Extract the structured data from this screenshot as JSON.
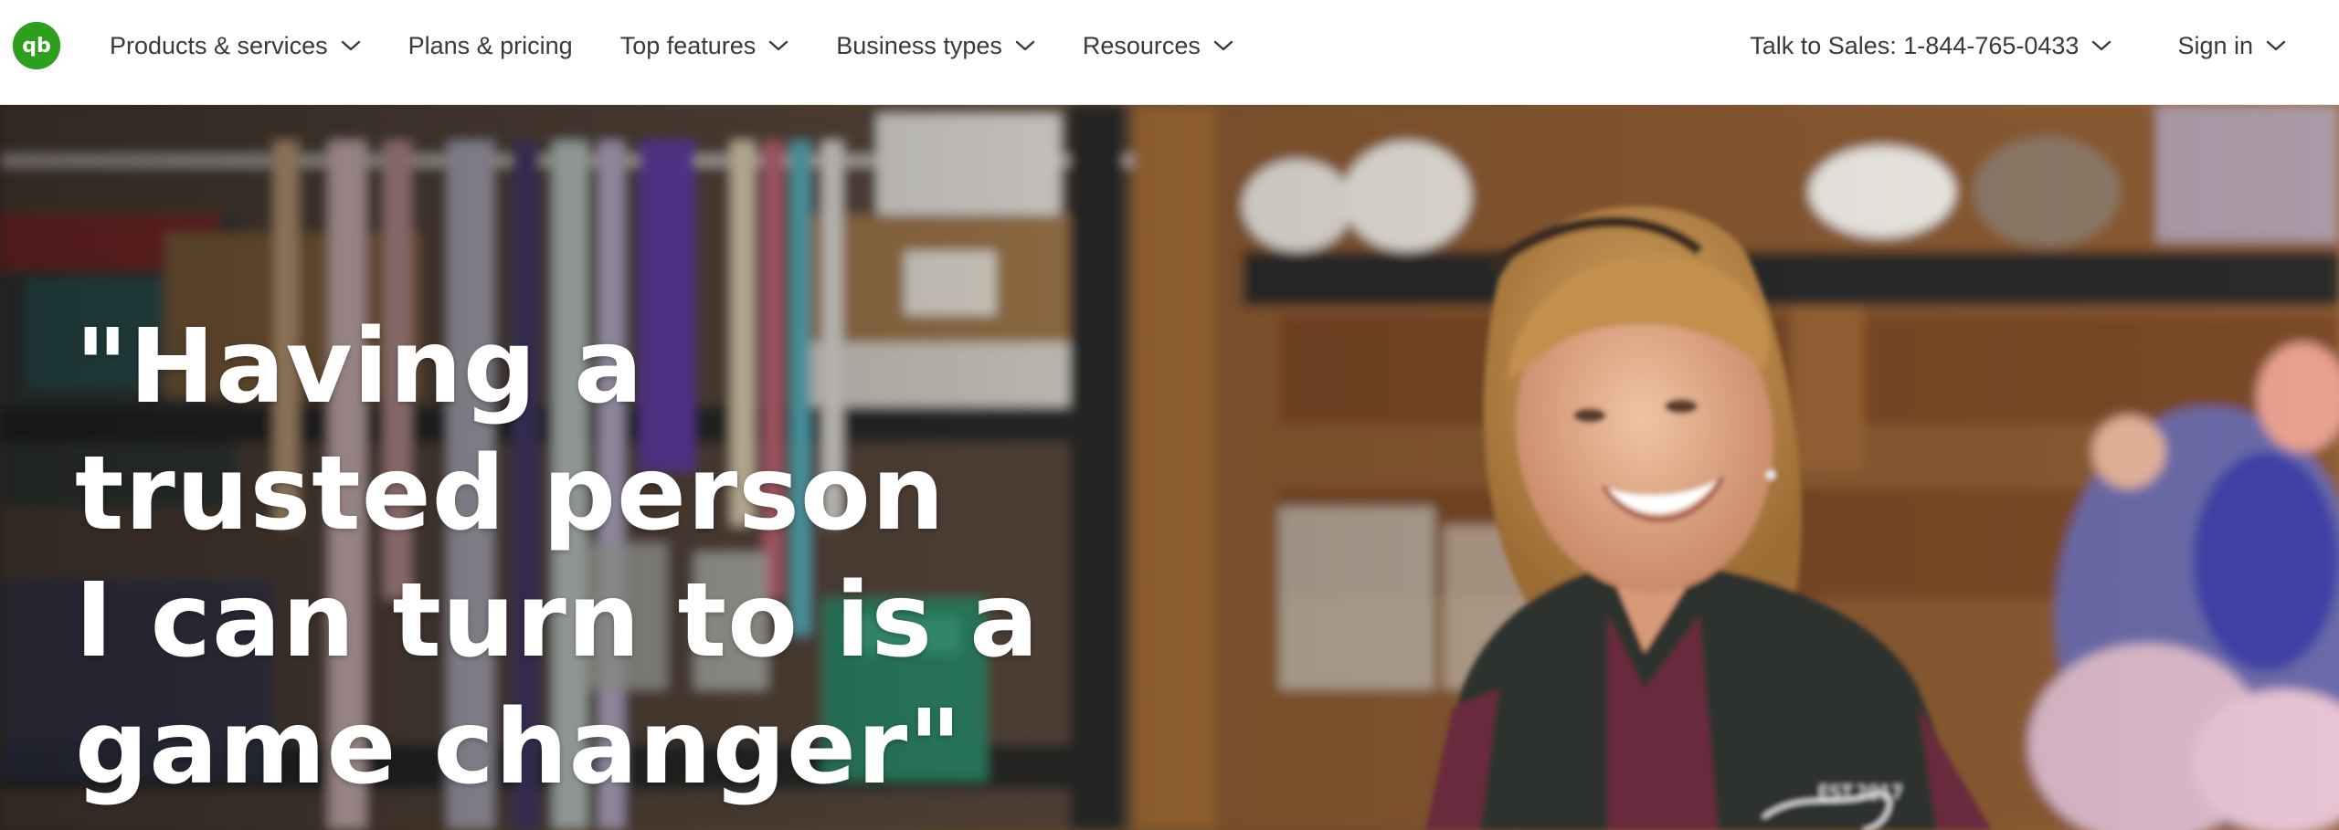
{
  "header": {
    "logo_icon": "quickbooks-logo-icon",
    "logo_text": "qb",
    "brand_color": "#2ca01c",
    "nav_left": [
      {
        "label": "Products & services",
        "has_dropdown": true
      },
      {
        "label": "Plans & pricing",
        "has_dropdown": false
      },
      {
        "label": "Top features",
        "has_dropdown": true
      },
      {
        "label": "Business types",
        "has_dropdown": true
      },
      {
        "label": "Resources",
        "has_dropdown": true
      }
    ],
    "sales_label": "Talk to Sales: 1-844-765-0433",
    "signin_label": "Sign in"
  },
  "hero": {
    "headline_lines": [
      "\"Having a",
      "trusted person",
      "I can turn to is a",
      "game changer\""
    ],
    "image": "florist-woman-smiling-in-shop-photo",
    "vest_text": "EST.2017"
  }
}
